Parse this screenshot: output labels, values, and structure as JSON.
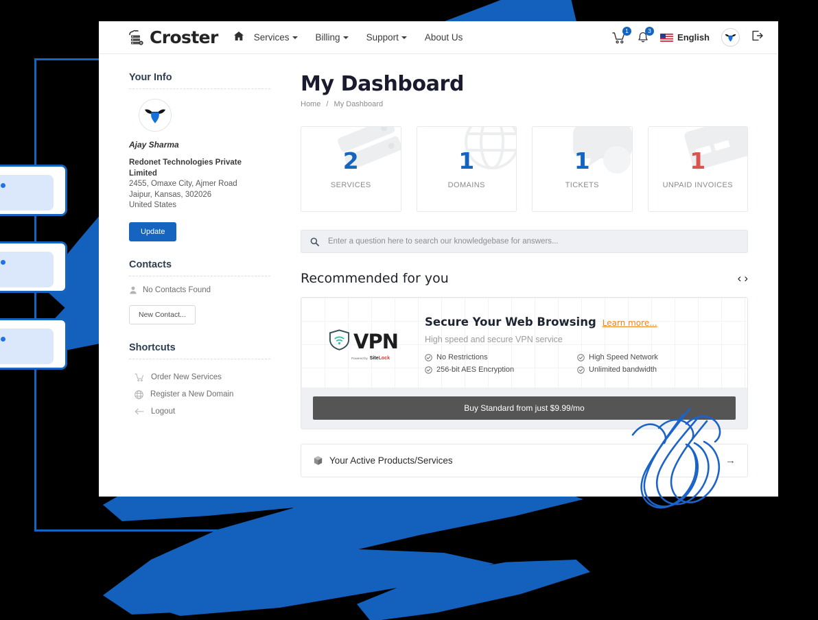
{
  "navbar": {
    "brand": "Croster",
    "brand_icon": "cloud-server-icon",
    "home_icon": "home-icon",
    "links": [
      {
        "label": "Services",
        "caret": true
      },
      {
        "label": "Billing",
        "caret": true
      },
      {
        "label": "Support",
        "caret": true
      },
      {
        "label": "About Us",
        "caret": false
      }
    ],
    "cart_icon": "shopping-cart-icon",
    "cart_badge": "1",
    "bell_icon": "bell-icon",
    "bell_badge": "3",
    "flag_icon": "us-flag-icon",
    "language": "English",
    "avatar_icon": "bull-avatar-icon",
    "logout_icon": "logout-icon"
  },
  "sidebar": {
    "your_info_heading": "Your Info",
    "avatar_icon": "bull-avatar-icon",
    "user_name": "Ajay Sharma",
    "company": "Redonet Technologies Private Limited",
    "address_line1": "2455, Omaxe City, Ajmer Road",
    "address_line2": "Jaipur, Kansas, 302026",
    "address_line3": "United States",
    "update_label": "Update",
    "contacts_heading": "Contacts",
    "contacts_icon": "user-icon",
    "contacts_empty": "No Contacts Found",
    "new_contact_label": "New Contact...",
    "shortcuts_heading": "Shortcuts",
    "shortcuts": [
      {
        "label": "Order New Services",
        "icon": "cart-icon"
      },
      {
        "label": "Register a New Domain",
        "icon": "globe-icon"
      },
      {
        "label": "Logout",
        "icon": "arrow-left-icon"
      }
    ]
  },
  "main": {
    "title": "My Dashboard",
    "breadcrumb_home": "Home",
    "breadcrumb_sep": "/",
    "breadcrumb_current": "My Dashboard",
    "stats": [
      {
        "value": "2",
        "label": "SERVICES",
        "color": "#1565c0",
        "watermark": "server-rack-icon"
      },
      {
        "value": "1",
        "label": "DOMAINS",
        "color": "#1565c0",
        "watermark": "globe-icon"
      },
      {
        "value": "1",
        "label": "TICKETS",
        "color": "#1565c0",
        "watermark": "speech-bubble-icon"
      },
      {
        "value": "1",
        "label": "UNPAID INVOICES",
        "color": "#d9534f",
        "watermark": "credit-card-icon"
      }
    ],
    "search": {
      "icon": "search-icon",
      "placeholder": "Enter a question here to search our knowledgebase for answers...",
      "value": ""
    },
    "recommended_heading": "Recommended for you",
    "prev_icon": "chevron-left-icon",
    "next_icon": "chevron-right-icon",
    "promo": {
      "logo_word": "VPN",
      "logo_icon": "shield-wifi-icon",
      "powered_by": "Powered by",
      "sitelock_a": "Site",
      "sitelock_b": "Lock",
      "heading": "Secure Your Web Browsing",
      "learn_more": "Learn more...",
      "subtitle": "High speed and secure VPN service",
      "features": [
        "No Restrictions",
        "High Speed Network",
        "256-bit AES Encryption",
        "Unlimited bandwidth"
      ],
      "buy_label": "Buy Standard from just $9.99/mo"
    },
    "active_panel": {
      "icon": "cube-icon",
      "title": "Your Active Products/Services",
      "arrow_icon": "arrow-right-icon"
    }
  },
  "decor": {
    "accent_blue": "#1565c0",
    "brush_blue": "#1460bd",
    "window_fill": "#dbe7fb",
    "scribble_color": "#1b62c9"
  }
}
